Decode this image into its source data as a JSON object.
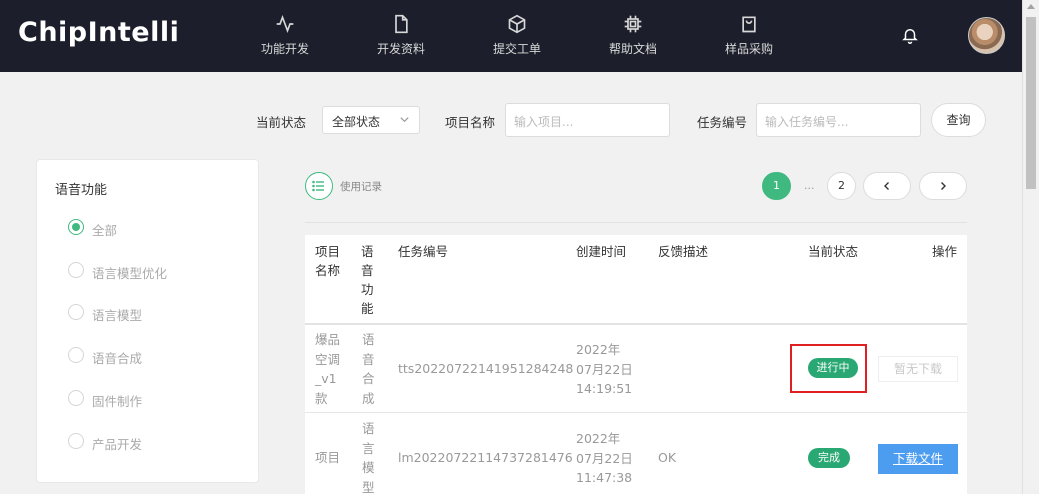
{
  "app": {
    "logo": "ChipIntelli"
  },
  "nav": {
    "items": [
      {
        "label": "功能开发",
        "icon": "activity-icon"
      },
      {
        "label": "开发资料",
        "icon": "file-icon"
      },
      {
        "label": "提交工单",
        "icon": "package-icon"
      },
      {
        "label": "帮助文档",
        "icon": "chip-icon"
      },
      {
        "label": "样品采购",
        "icon": "shopping-bag-icon"
      }
    ]
  },
  "filters": {
    "status_label": "当前状态",
    "status_value": "全部状态",
    "project_label": "项目名称",
    "project_placeholder": "输入项目...",
    "task_label": "任务编号",
    "task_placeholder": "输入任务编号...",
    "query_button": "查询"
  },
  "sidebar": {
    "title": "语音功能",
    "items": [
      {
        "label": "全部",
        "selected": true
      },
      {
        "label": "语言模型优化",
        "selected": false
      },
      {
        "label": "语言模型",
        "selected": false
      },
      {
        "label": "语音合成",
        "selected": false
      },
      {
        "label": "固件制作",
        "selected": false
      },
      {
        "label": "产品开发",
        "selected": false
      }
    ]
  },
  "records": {
    "label": "使用记录"
  },
  "pagination": {
    "page1": "1",
    "ellipsis": "...",
    "page2": "2",
    "prev": "‹",
    "next": "›"
  },
  "table": {
    "headers": {
      "project": "项目名称",
      "function": "语音功能",
      "task_id": "任务编号",
      "created": "创建时间",
      "feedback": "反馈描述",
      "status": "当前状态",
      "action": "操作"
    },
    "rows": [
      {
        "project": "爆品空调_v1款",
        "function": "语音合成",
        "task_id": "tts20220722141951284248",
        "created": "2022年07月22日14:19:51",
        "feedback": "",
        "status": "进行中",
        "action": "暂无下载"
      },
      {
        "project": "项目",
        "function": "语言模型",
        "task_id": "lm20220722114737281476",
        "created": "2022年07月22日11:47:38",
        "feedback": "OK",
        "status": "完成",
        "action": "下载文件"
      }
    ]
  },
  "colors": {
    "accent": "#3fb97f",
    "topbar": "#1c1f2b",
    "download": "#4c9df0",
    "highlight": "#e02020"
  }
}
